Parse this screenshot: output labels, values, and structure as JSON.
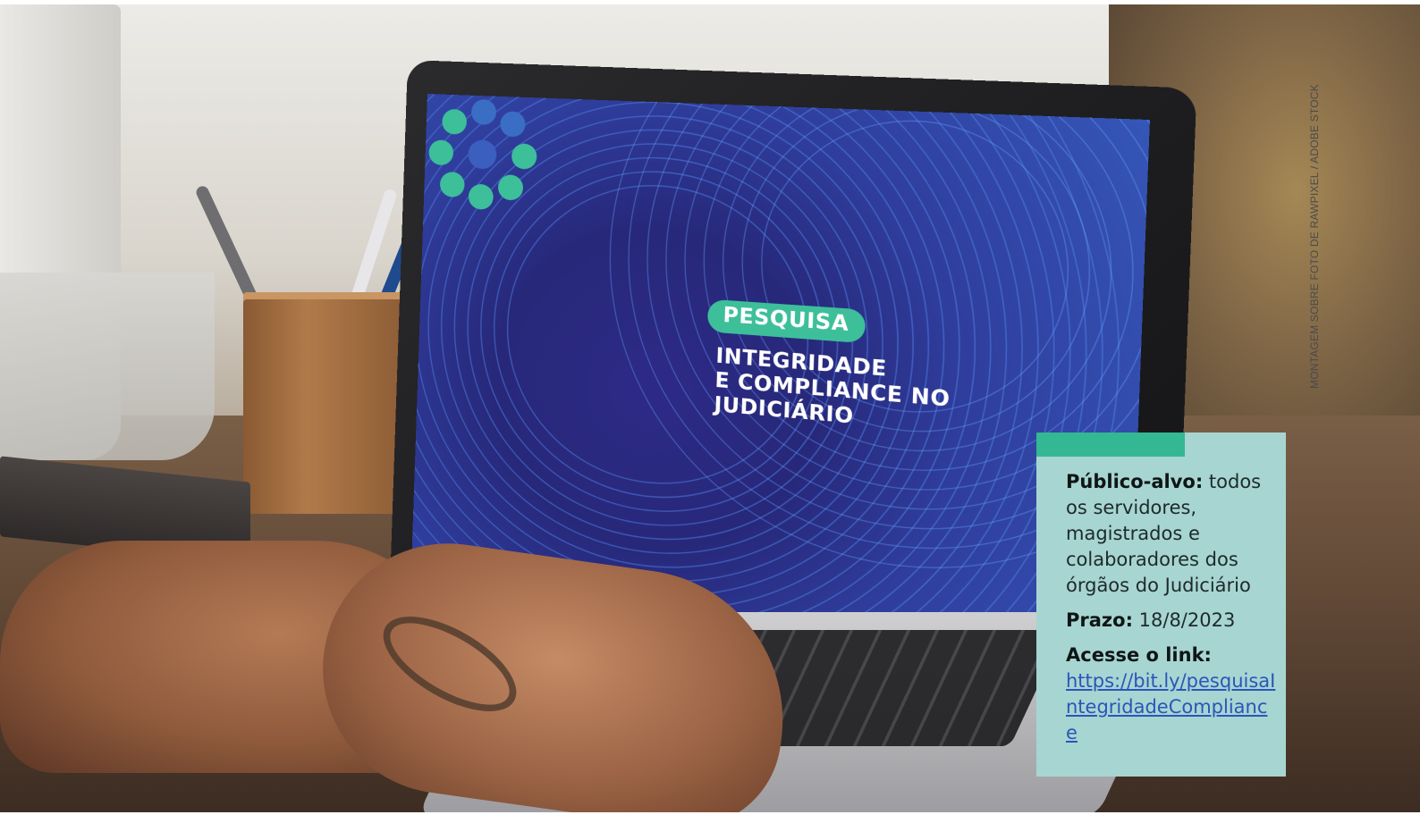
{
  "photo": {
    "credit": "MONTAGEM SOBRE FOTO DE RAWPIXEL / ADOBE STOCK",
    "screen": {
      "badge": "PESQUISA",
      "title_lines": [
        "INTEGRIDADE",
        "E COMPLIANCE NO",
        "JUDICIÁRIO"
      ],
      "logo": "circle-of-dots-logo-icon",
      "colors": {
        "screen_blue": "#2d2a86",
        "accent_green": "#3dbf9a"
      }
    }
  },
  "info_box": {
    "audience_label": "Público-alvo:",
    "audience_text": " todos os servidores, magistrados e colaboradores dos órgãos do Judiciário",
    "deadline_label": "Prazo:",
    "deadline_value": " 18/8/2023",
    "link_label": "Acesse o link:",
    "link_url": "https://bit.ly/pesquisaIntegridadeCompliance",
    "colors": {
      "box_bg": "#a7d5d2",
      "bar": "#33b893",
      "link": "#2b56b8"
    }
  }
}
